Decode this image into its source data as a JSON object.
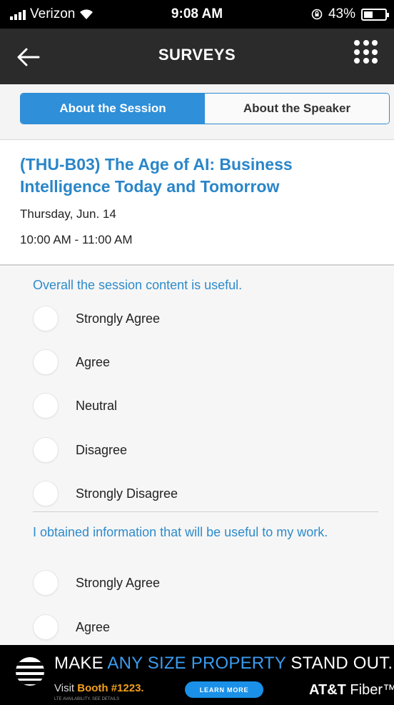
{
  "status_bar": {
    "carrier": "Verizon",
    "time": "9:08 AM",
    "battery": "43%",
    "battery_level": 0.43
  },
  "nav": {
    "title": "SURVEYS",
    "back_icon": "arrow-left-icon",
    "menu_icon": "grid-menu-icon"
  },
  "tabs": [
    {
      "label": "About the Session",
      "active": true
    },
    {
      "label": "About the Speaker",
      "active": false
    }
  ],
  "session": {
    "title": "(THU-B03) The Age of AI: Business Intelligence Today and Tomorrow",
    "date": "Thursday, Jun. 14",
    "time": "10:00 AM - 11:00 AM"
  },
  "questions": [
    {
      "text": "Overall the session content is useful.",
      "options": [
        "Strongly Agree",
        "Agree",
        "Neutral",
        "Disagree",
        "Strongly Disagree"
      ]
    },
    {
      "text": "I obtained information that will be useful to my work.",
      "options": [
        "Strongly Agree",
        "Agree"
      ]
    }
  ],
  "ad": {
    "headline_pre": "MAKE ",
    "headline_highlight": "ANY SIZE PROPERTY",
    "headline_post": " STAND OUT.",
    "booth_pre": "Visit ",
    "booth_highlight": "Booth #1223.",
    "fine_print": "LTE AVAILABILITY. SEE DETAILS",
    "button": "LEARN MORE",
    "brand_bold": "AT&T",
    "brand_rest": " Fiber™"
  },
  "colors": {
    "accent": "#2f8fd8",
    "question_text": "#2d8bcb",
    "nav_bg": "#2b2b2b",
    "ad_highlight": "#3a9cf0",
    "ad_booth": "#f2a01e"
  }
}
